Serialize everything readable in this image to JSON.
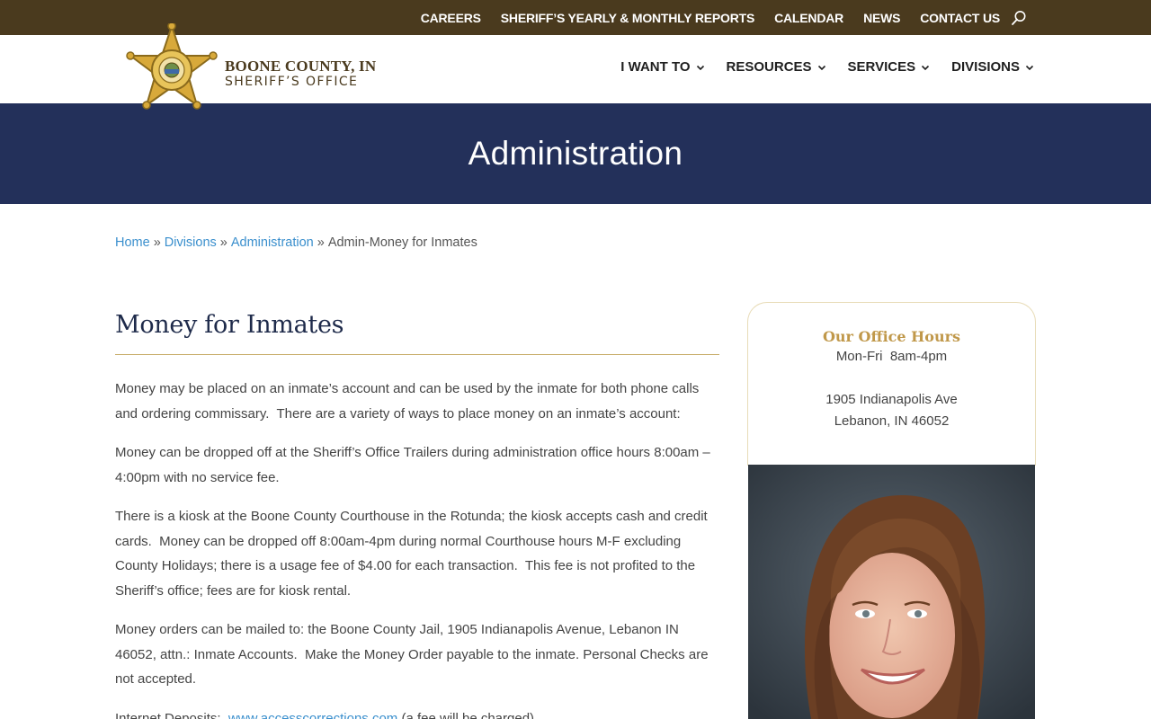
{
  "topbar": {
    "links": [
      "CAREERS",
      "SHERIFF’S YEARLY & MONTHLY REPORTS",
      "CALENDAR",
      "NEWS",
      "CONTACT US"
    ],
    "search_icon": "search-icon"
  },
  "logo": {
    "line1": "BOONE COUNTY, IN",
    "line2": "SHERIFF’S OFFICE",
    "badge_icon": "sheriff-star-badge-icon"
  },
  "mainnav": {
    "items": [
      "I WANT TO",
      "RESOURCES",
      "SERVICES",
      "DIVISIONS"
    ],
    "chevron_icon": "chevron-down-icon"
  },
  "hero": {
    "title": "Administration"
  },
  "breadcrumb": {
    "items": [
      {
        "label": "Home",
        "link": true
      },
      {
        "label": "Divisions",
        "link": true
      },
      {
        "label": "Administration",
        "link": true
      },
      {
        "label": "Admin-Money for Inmates",
        "link": false
      }
    ],
    "separator": "»"
  },
  "content": {
    "heading": "Money for Inmates",
    "paragraphs": [
      "Money may be placed on an inmate’s account and can be used by the inmate for both phone calls and ordering commissary.  There are a variety of ways to place money on an inmate’s account:",
      "Money can be dropped off at the Sheriff’s Office Trailers during administration office hours 8:00am – 4:00pm with no service fee.",
      "There is a kiosk at the Boone County Courthouse in the Rotunda; the kiosk accepts cash and credit cards.  Money can be dropped off 8:00am-4pm during normal Courthouse hours M-F excluding County Holidays; there is a usage fee of $4.00 for each transaction.  This fee is not profited to the Sheriff’s office; fees are for kiosk rental.",
      "Money orders can be mailed to: the Boone County Jail, 1905 Indianapolis Avenue, Lebanon IN 46052, attn.: Inmate Accounts.  Make the Money Order payable to the inmate. Personal Checks are not accepted."
    ],
    "internet_label": "Internet Deposits:  ",
    "internet_link": "www.accesscorrections.com",
    "internet_suffix": " (a fee will be charged)"
  },
  "sidebar": {
    "title": "Our Office Hours",
    "hours": "Mon-Fri  8am-4pm",
    "address_line1": "1905 Indianapolis Ave",
    "address_line2": "Lebanon, IN 46052",
    "photo_icon": "staff-portrait-photo"
  },
  "colors": {
    "topbar_bg": "#4a3a1e",
    "hero_bg": "#23305a",
    "link": "#3a8fcd",
    "gold": "#c0984a"
  }
}
